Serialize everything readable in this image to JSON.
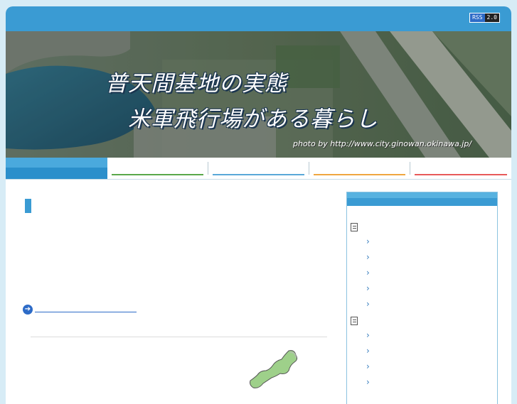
{
  "header": {
    "rss_label": "RSS",
    "rss_version": "2.0"
  },
  "banner": {
    "title_line1": "普天間基地の実態",
    "title_line2": "米軍飛行場がある暮らし",
    "photo_credit": "photo by http://www.city.ginowan.okinawa.jp/"
  },
  "nav": {
    "items": [
      {
        "label": "",
        "color": "#2b8fcb"
      },
      {
        "label": "",
        "color": "#5aa84a"
      },
      {
        "label": "",
        "color": "#5aa8d8"
      },
      {
        "label": "",
        "color": "#f0a640"
      },
      {
        "label": "",
        "color": "#e85a5a"
      }
    ]
  },
  "colors": {
    "brand_blue": "#3a9bd3",
    "link_blue": "#2d6bc7",
    "page_bg": "#d7ecf6",
    "map_green": "#9ed08a"
  },
  "sidebar": {
    "groups": [
      {
        "icon": "document-icon",
        "links": 5
      },
      {
        "icon": "document-icon",
        "links": 4
      }
    ]
  }
}
